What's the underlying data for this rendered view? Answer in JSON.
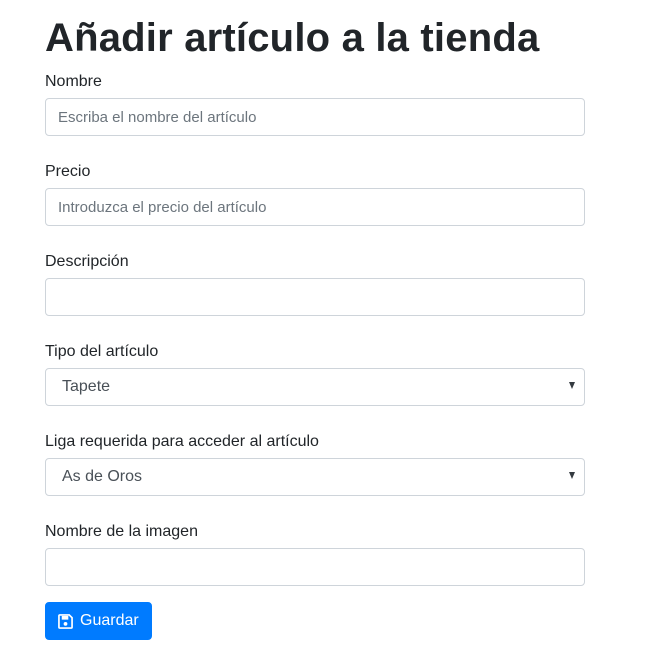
{
  "page": {
    "title": "Añadir artículo a la tienda"
  },
  "form": {
    "nombre": {
      "label": "Nombre",
      "placeholder": "Escriba el nombre del artículo",
      "value": ""
    },
    "precio": {
      "label": "Precio",
      "placeholder": "Introduzca el precio del artículo",
      "value": ""
    },
    "descripcion": {
      "label": "Descripción",
      "placeholder": "",
      "value": ""
    },
    "tipo": {
      "label": "Tipo del artículo",
      "selected": "Tapete"
    },
    "liga": {
      "label": "Liga requerida para acceder al artículo",
      "selected": "As de Oros"
    },
    "imagen": {
      "label": "Nombre de la imagen",
      "placeholder": "",
      "value": ""
    },
    "submit": {
      "label": "Guardar",
      "icon": "save-icon"
    }
  },
  "colors": {
    "primary": "#007bff",
    "border": "#ced4da",
    "text": "#212529"
  }
}
